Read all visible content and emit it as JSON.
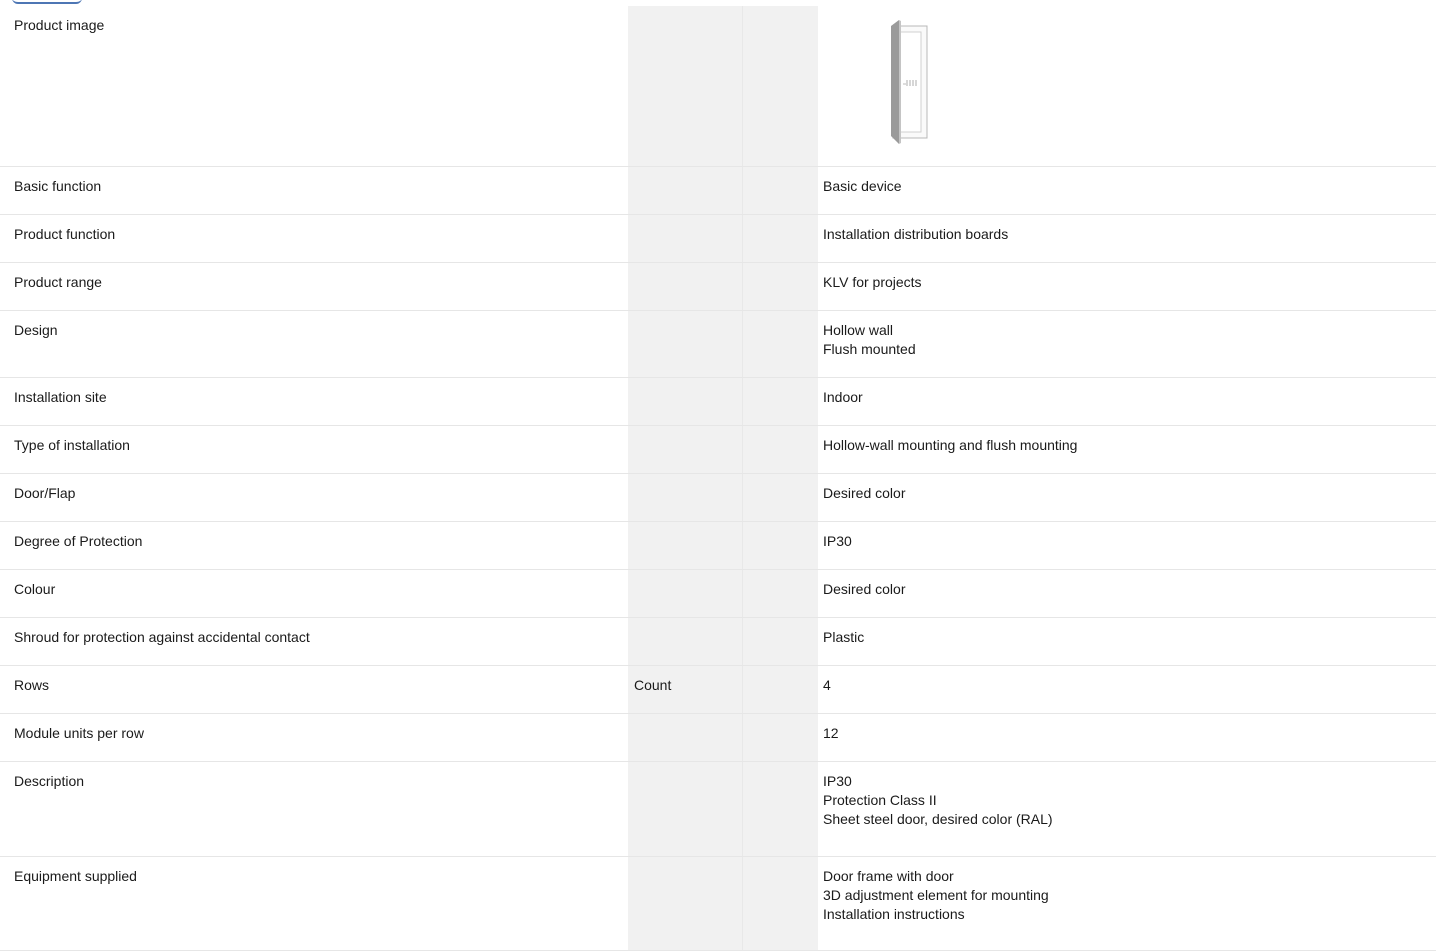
{
  "rows": [
    {
      "name": "Product image",
      "unit": "",
      "values": []
    },
    {
      "name": "Basic function",
      "unit": "",
      "values": [
        "Basic device"
      ]
    },
    {
      "name": "Product function",
      "unit": "",
      "values": [
        "Installation distribution boards"
      ]
    },
    {
      "name": "Product range",
      "unit": "",
      "values": [
        "KLV for projects"
      ]
    },
    {
      "name": "Design",
      "unit": "",
      "values": [
        "Hollow wall",
        "Flush mounted"
      ]
    },
    {
      "name": "Installation site",
      "unit": "",
      "values": [
        "Indoor"
      ]
    },
    {
      "name": "Type of installation",
      "unit": "",
      "values": [
        "Hollow-wall mounting and flush mounting"
      ]
    },
    {
      "name": "Door/Flap",
      "unit": "",
      "values": [
        "Desired color"
      ]
    },
    {
      "name": "Degree of Protection",
      "unit": "",
      "values": [
        "IP30"
      ]
    },
    {
      "name": "Colour",
      "unit": "",
      "values": [
        "Desired color"
      ]
    },
    {
      "name": "Shroud for protection against accidental contact",
      "unit": "",
      "values": [
        "Plastic"
      ]
    },
    {
      "name": "Rows",
      "unit": "Count",
      "values": [
        "4"
      ]
    },
    {
      "name": "Module units per row",
      "unit": "",
      "values": [
        "12"
      ]
    },
    {
      "name": "Description",
      "unit": "",
      "values": [
        "IP30",
        "Protection Class II",
        "Sheet steel door, desired color (RAL)"
      ]
    },
    {
      "name": "Equipment supplied",
      "unit": "",
      "values": [
        "Door frame with door",
        "3D adjustment element for mounting",
        "Installation instructions"
      ]
    }
  ],
  "product_image": {
    "icon": "door-frame-icon"
  }
}
